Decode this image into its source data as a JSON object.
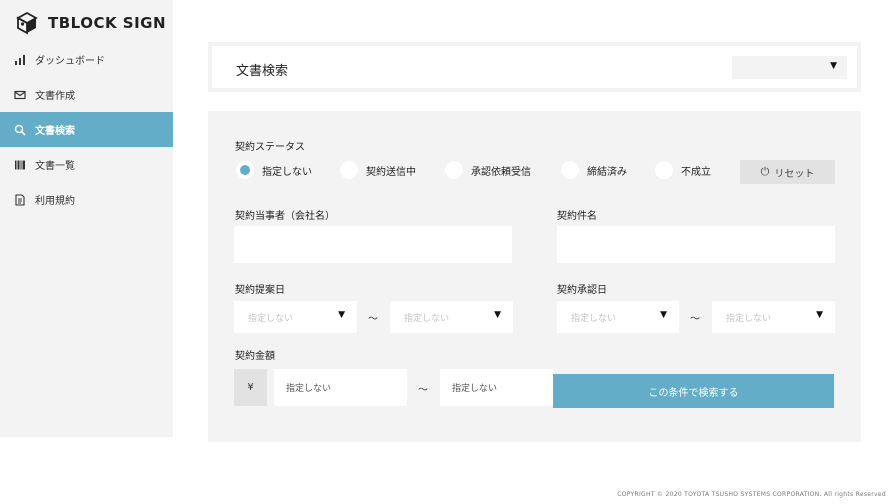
{
  "app": {
    "logo_text": "TBLOCK SIGN"
  },
  "sidebar": {
    "items": [
      {
        "label": "ダッシュボード",
        "icon": "bar-chart-icon",
        "active": false
      },
      {
        "label": "文書作成",
        "icon": "envelope-icon",
        "active": false
      },
      {
        "label": "文書検索",
        "icon": "search-icon",
        "active": true
      },
      {
        "label": "文書一覧",
        "icon": "barcode-list-icon",
        "active": false
      },
      {
        "label": "利用規約",
        "icon": "document-icon",
        "active": false
      }
    ]
  },
  "header": {
    "title": "文書検索",
    "select_value": ""
  },
  "form": {
    "status_label": "契約ステータス",
    "status_options": [
      "指定しない",
      "契約送信中",
      "承認依頼受信",
      "締結済み",
      "不成立"
    ],
    "status_selected": "指定しない",
    "reset_label": "リセット",
    "party_label": "契約当事者（会社名）",
    "party_value": "",
    "contract_name_label": "契約件名",
    "contract_name_value": "",
    "proposal_date_label": "契約提案日",
    "approval_date_label": "契約承認日",
    "date_placeholder": "指定しない",
    "tilde": "～",
    "amount_label": "契約金額",
    "currency": "¥",
    "amount_placeholder": "指定しない",
    "search_button": "この条件で検索する"
  },
  "footer": {
    "copyright": "COPYRIGHT © 2020 TOYOTA TSUSHO SYSTEMS CORPORATION. All rights Reserved"
  },
  "colors": {
    "accent": "#64adc9",
    "panel_bg": "#f3f3f3",
    "button_gray": "#e2e2e2"
  }
}
